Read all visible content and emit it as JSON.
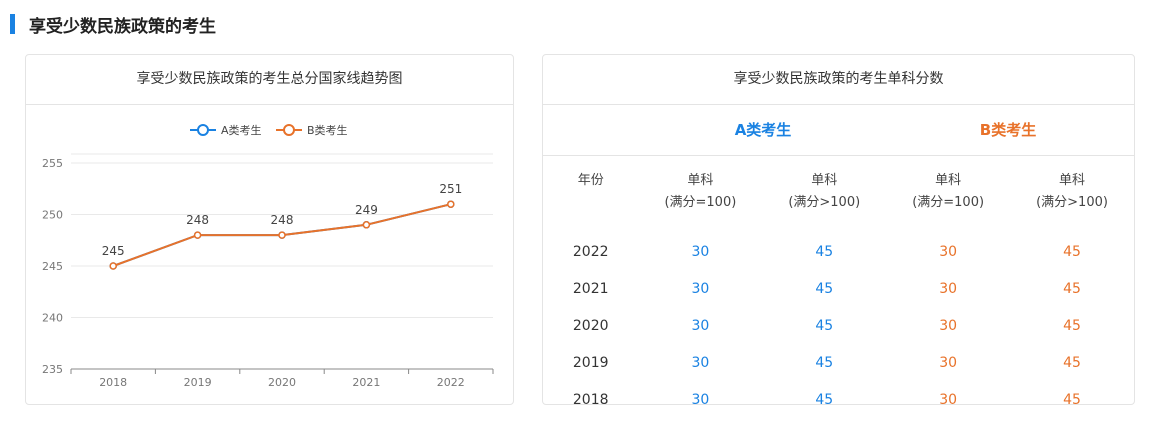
{
  "section": {
    "title": "享受少数民族政策的考生"
  },
  "colors": {
    "accent": "#1a82e2",
    "series_a": "#1a82e2",
    "series_b": "#e8722a"
  },
  "chart_card": {
    "title": "享受少数民族政策的考生总分国家线趋势图"
  },
  "chart_data": {
    "type": "line",
    "title": "享受少数民族政策的考生总分国家线趋势图",
    "x": [
      "2018",
      "2019",
      "2020",
      "2021",
      "2022"
    ],
    "series": [
      {
        "name": "A类考生",
        "values": [
          245,
          248,
          248,
          249,
          251
        ],
        "color": "#1a82e2"
      },
      {
        "name": "B类考生",
        "values": [
          245,
          248,
          248,
          249,
          251
        ],
        "color": "#e8722a"
      }
    ],
    "yticks": [
      235,
      240,
      245,
      250,
      255
    ],
    "ylim": [
      235,
      255
    ],
    "grid": true,
    "legend": "top-center",
    "data_labels": [
      "245",
      "248",
      "248",
      "249",
      "251"
    ]
  },
  "table_card": {
    "title": "享受少数民族政策的考生单科分数",
    "group_a": "A类考生",
    "group_b": "B类考生",
    "headers": [
      {
        "line1": "年份",
        "line2": ""
      },
      {
        "line1": "单科",
        "line2": "(满分=100)"
      },
      {
        "line1": "单科",
        "line2": "(满分>100)"
      },
      {
        "line1": "单科",
        "line2": "(满分=100)"
      },
      {
        "line1": "单科",
        "line2": "(满分>100)"
      }
    ],
    "rows": [
      {
        "year": "2022",
        "a100": "30",
        "a_gt100": "45",
        "b100": "30",
        "b_gt100": "45"
      },
      {
        "year": "2021",
        "a100": "30",
        "a_gt100": "45",
        "b100": "30",
        "b_gt100": "45"
      },
      {
        "year": "2020",
        "a100": "30",
        "a_gt100": "45",
        "b100": "30",
        "b_gt100": "45"
      },
      {
        "year": "2019",
        "a100": "30",
        "a_gt100": "45",
        "b100": "30",
        "b_gt100": "45"
      },
      {
        "year": "2018",
        "a100": "30",
        "a_gt100": "45",
        "b100": "30",
        "b_gt100": "45"
      }
    ]
  }
}
